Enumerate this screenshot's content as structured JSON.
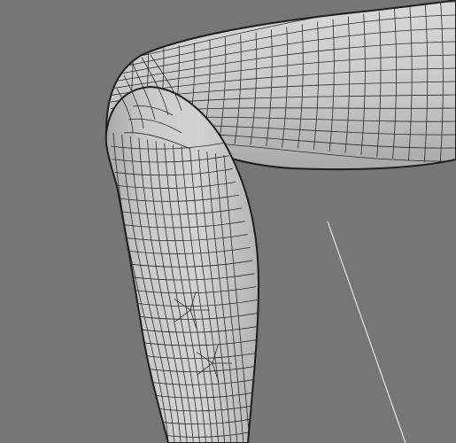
{
  "viewport": {
    "kind": "3d-modeling-viewport",
    "background_color": "#767676",
    "model": {
      "subject": "bent-arm-wireframe-mesh",
      "surface_color": "#c4c4c4",
      "wire_color": "#2a2a2a"
    },
    "guide_line_color": "#e6e6e6"
  }
}
